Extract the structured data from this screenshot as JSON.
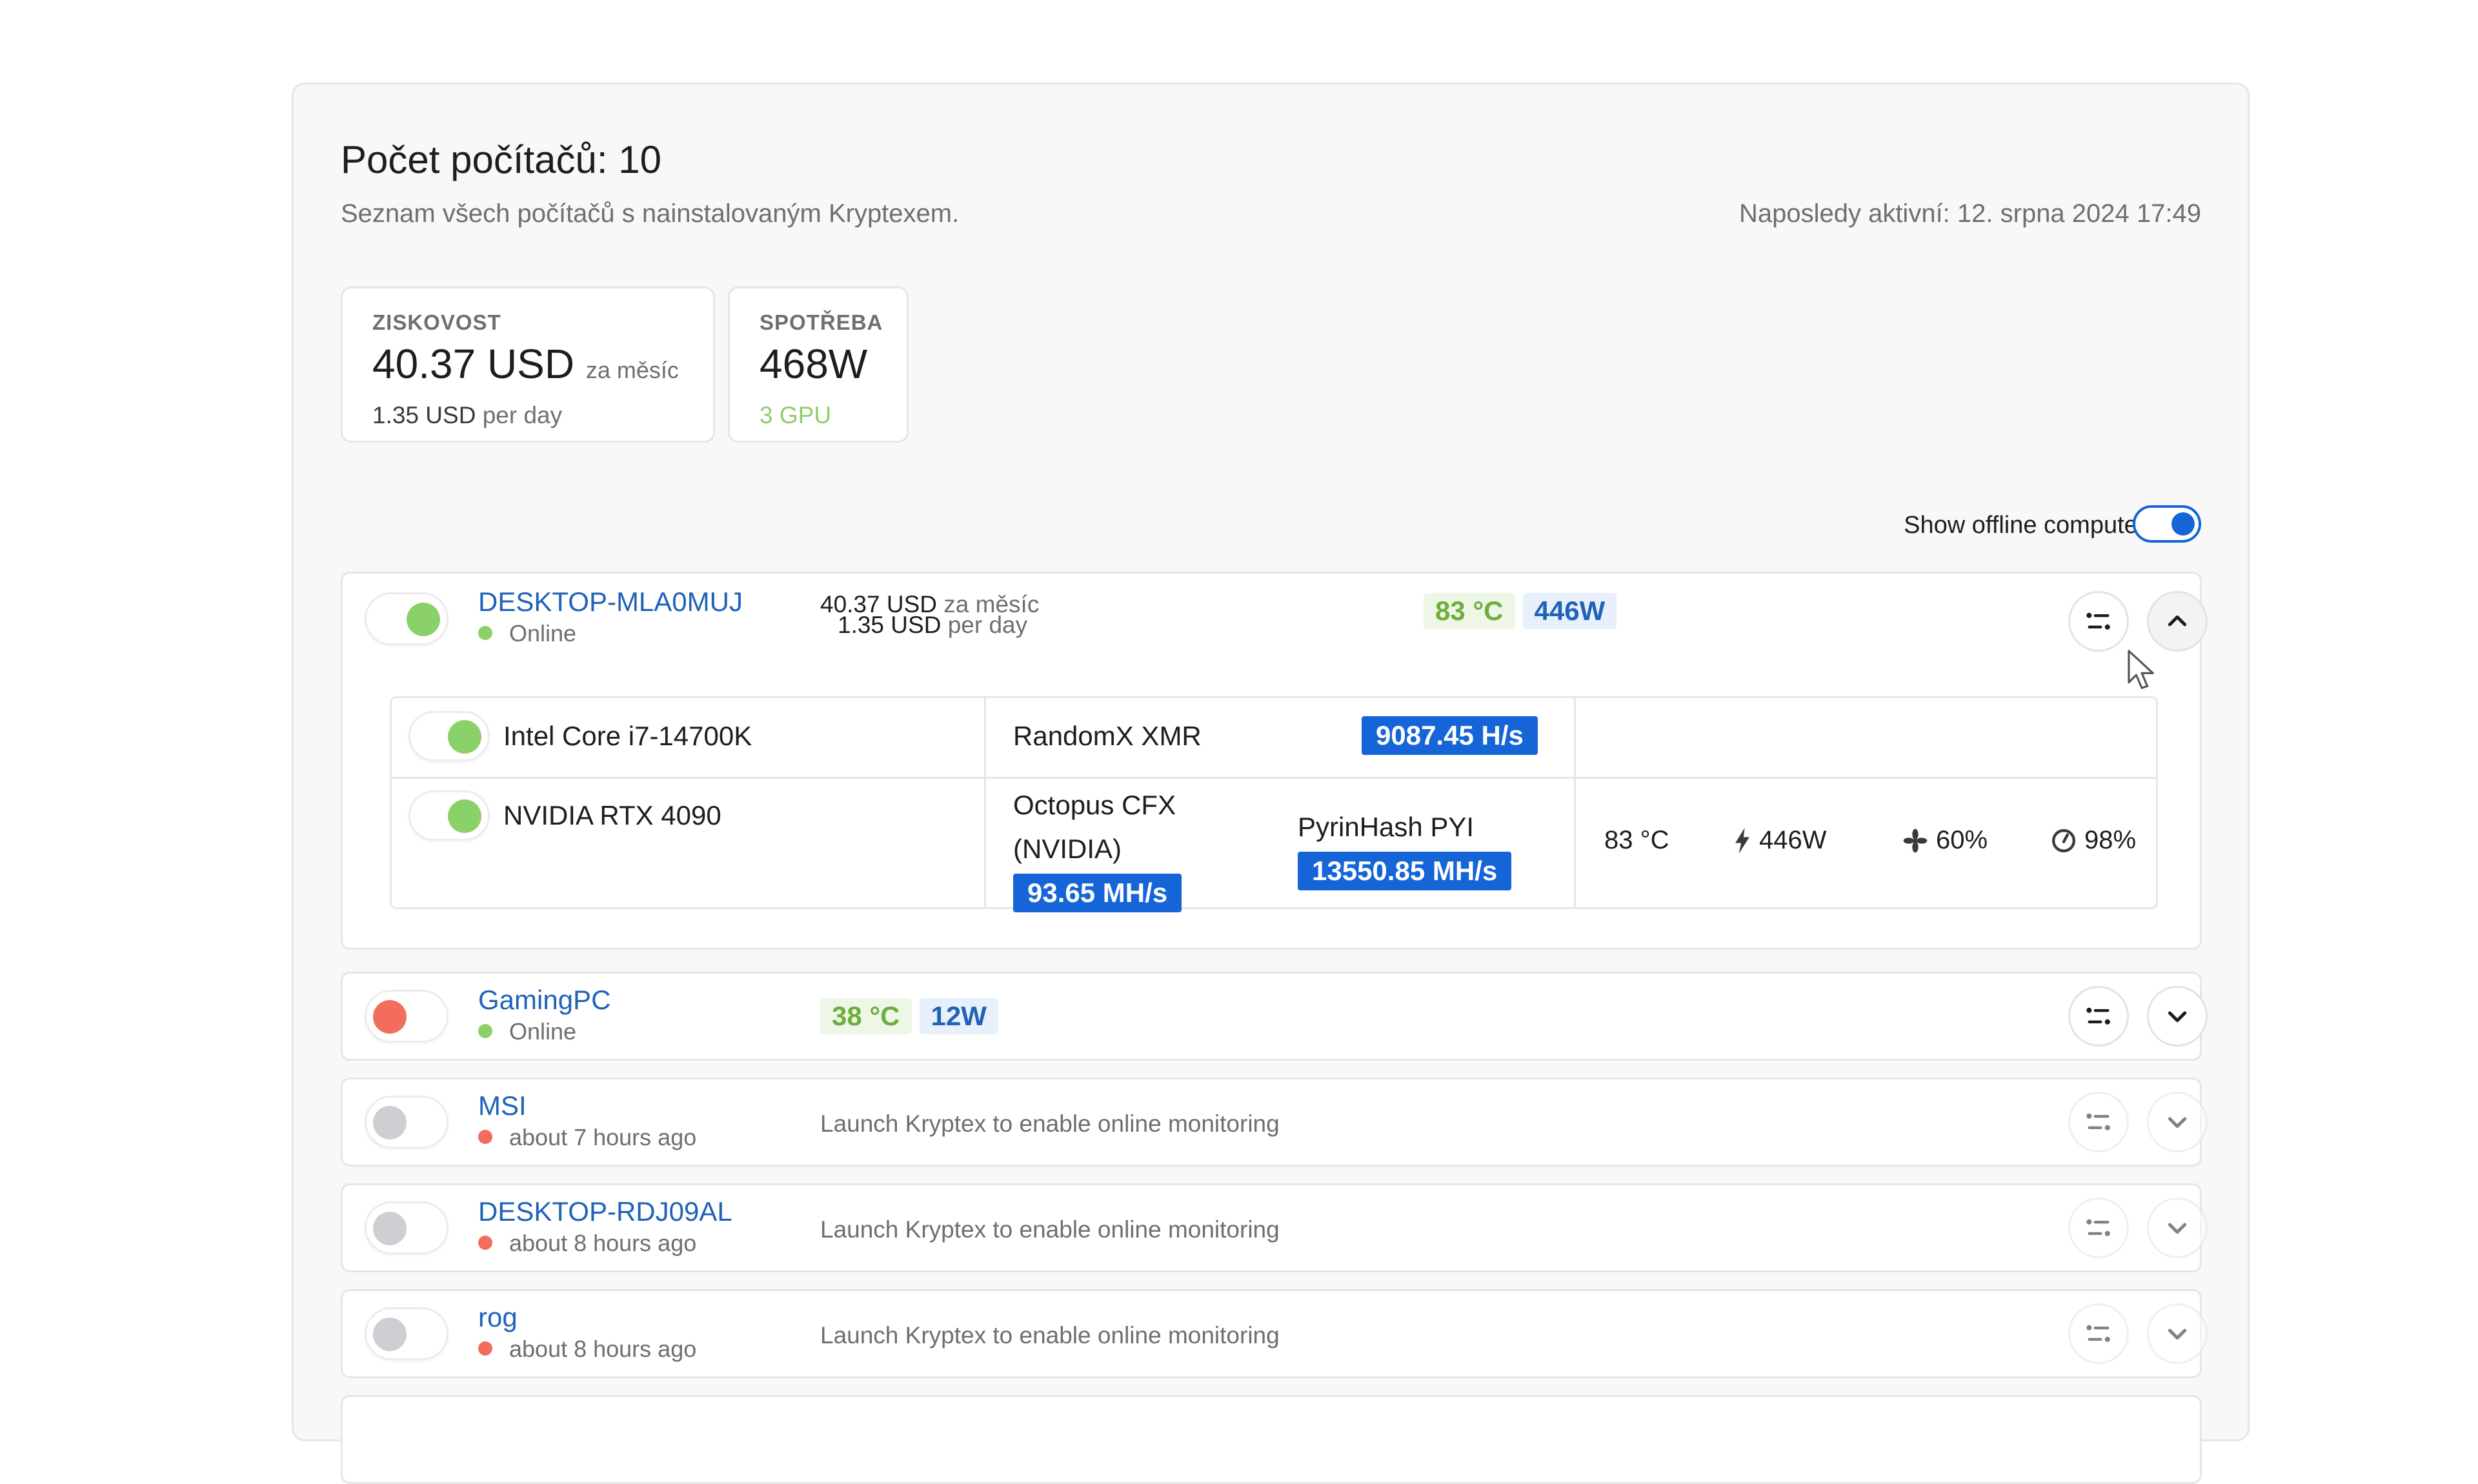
{
  "header": {
    "title": "Počet počítačů: 10",
    "subtitle": "Seznam všech počítačů s nainstalovaným Kryptexem.",
    "last_active": "Naposledy aktivní: 12. srpna 2024 17:49"
  },
  "stats": {
    "profit": {
      "label": "ZISKOVOST",
      "value": "40.37 USD",
      "value_unit": "za měsíc",
      "per_day_value": "1.35 USD",
      "per_day_unit": "per day"
    },
    "consumption": {
      "label": "SPOTŘEBA",
      "value": "468W",
      "sub": "3 GPU"
    }
  },
  "offline_toggle": {
    "label": "Show offline computers:",
    "checked": true
  },
  "computers": [
    {
      "name": "DESKTOP-MLA0MUJ",
      "status": "Online",
      "status_color": "green",
      "toggle": "on",
      "monthly_value": "40.37 USD",
      "monthly_unit": "za měsíc",
      "daily_value": "1.35 USD",
      "daily_unit": "per day",
      "temp": "83 °C",
      "power": "446W",
      "expanded": true,
      "devices": [
        {
          "name": "Intel Core i7-14700K",
          "algorithm": "RandomX XMR",
          "hashrate": "9087.45 H/s"
        },
        {
          "name": "NVIDIA RTX 4090",
          "algorithm_line1": "Octopus CFX",
          "algorithm_line2": "(NVIDIA)",
          "hashrate": "93.65 MH/s",
          "dual_algorithm": "PyrinHash PYI",
          "dual_hashrate": "13550.85 MH/s",
          "temp": "83 °C",
          "power": "446W",
          "fan": "60%",
          "load": "98%"
        }
      ]
    },
    {
      "name": "GamingPC",
      "status": "Online",
      "status_color": "green",
      "toggle": "red",
      "temp": "38 °C",
      "power": "12W"
    },
    {
      "name": "MSI",
      "status": "about 7 hours ago",
      "status_color": "red",
      "toggle": "off",
      "message": "Launch Kryptex to enable online monitoring"
    },
    {
      "name": "DESKTOP-RDJ09AL",
      "status": "about 8 hours ago",
      "status_color": "red",
      "toggle": "off",
      "message": "Launch Kryptex to enable online monitoring"
    },
    {
      "name": "rog",
      "status": "about 8 hours ago",
      "status_color": "red",
      "toggle": "off",
      "message": "Launch Kryptex to enable online monitoring"
    }
  ],
  "icons": {
    "settings": "sliders-icon",
    "expand": "chevron-down-icon",
    "collapse": "chevron-up-icon",
    "power": "bolt-icon",
    "fan": "fan-icon",
    "load": "gauge-icon",
    "cursor": "mouse-pointer-icon"
  },
  "colors": {
    "accent": "#1565d8",
    "link": "#1f62b8",
    "online": "#8bd16a",
    "offline": "#f26d5b",
    "temp_text": "#6fae3c"
  }
}
